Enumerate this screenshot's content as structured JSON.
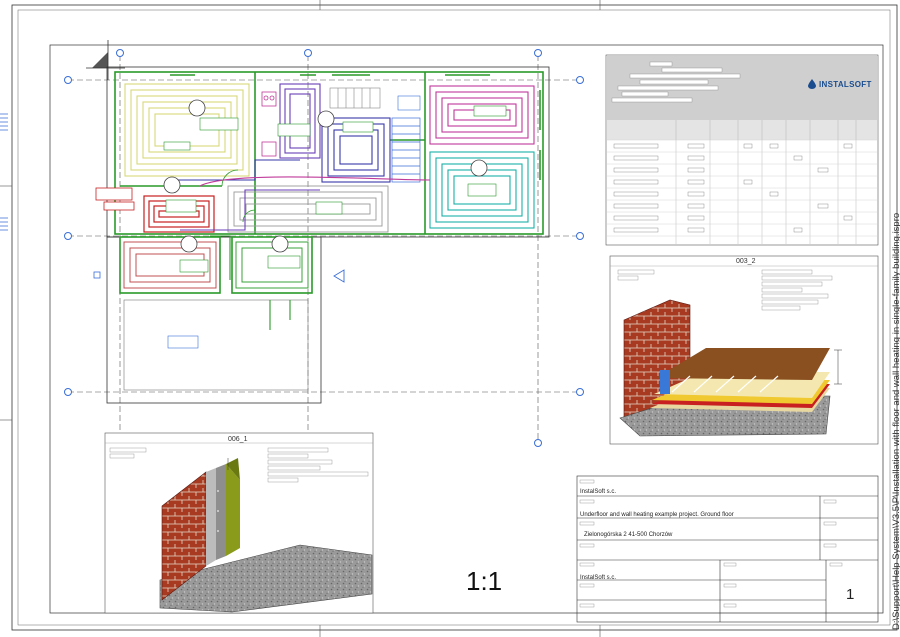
{
  "sheet": {
    "scale": "1:1",
    "sheet_number": "1",
    "file_path": "D:\\Support\\Help System\\V3.5\\P\\Installation with floor and wall heating in single-family building.ispro"
  },
  "title_block": {
    "company_top": "InstalSoft s.c.",
    "project": "Underfloor and wall heating example project. Ground floor",
    "address": "Zielonogórska 2 41-500 Chorzów",
    "company_bottom": "InstalSoft s.c."
  },
  "details": [
    {
      "label": "006_1",
      "kind": "wall-heating-section"
    },
    {
      "label": "003_2",
      "kind": "floor-heating-section"
    }
  ],
  "logo": {
    "text": "INSTALSOFT",
    "icon": "water-drop-icon"
  },
  "colors": {
    "zone_yellow": "#d8d87a",
    "zone_purple": "#6a3fb8",
    "zone_blue": "#3a3aa8",
    "zone_magenta": "#c03a9a",
    "zone_teal": "#1ab0a8",
    "zone_red": "#c82020",
    "zone_grey": "#9a9a9a",
    "wall_green": "#2a9a2a",
    "gridline_blue": "#3a6ed8",
    "brick": "#9a3020",
    "logo_blue": "#1a4d8f"
  }
}
